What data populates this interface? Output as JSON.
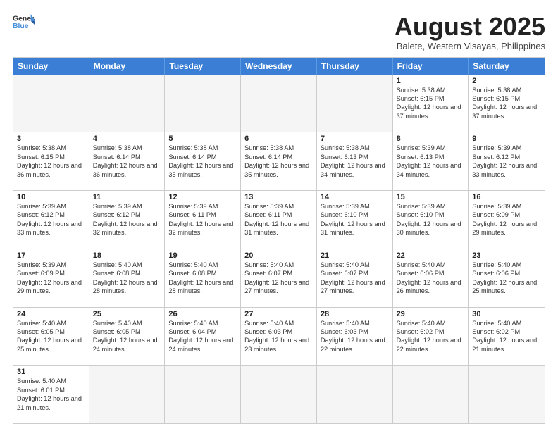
{
  "header": {
    "logo_general": "General",
    "logo_blue": "Blue",
    "month_title": "August 2025",
    "location": "Balete, Western Visayas, Philippines"
  },
  "days_of_week": [
    "Sunday",
    "Monday",
    "Tuesday",
    "Wednesday",
    "Thursday",
    "Friday",
    "Saturday"
  ],
  "weeks": [
    [
      {
        "day": "",
        "info": "",
        "empty": true
      },
      {
        "day": "",
        "info": "",
        "empty": true
      },
      {
        "day": "",
        "info": "",
        "empty": true
      },
      {
        "day": "",
        "info": "",
        "empty": true
      },
      {
        "day": "",
        "info": "",
        "empty": true
      },
      {
        "day": "1",
        "info": "Sunrise: 5:38 AM\nSunset: 6:15 PM\nDaylight: 12 hours and 37 minutes."
      },
      {
        "day": "2",
        "info": "Sunrise: 5:38 AM\nSunset: 6:15 PM\nDaylight: 12 hours and 37 minutes."
      }
    ],
    [
      {
        "day": "3",
        "info": "Sunrise: 5:38 AM\nSunset: 6:15 PM\nDaylight: 12 hours and 36 minutes."
      },
      {
        "day": "4",
        "info": "Sunrise: 5:38 AM\nSunset: 6:14 PM\nDaylight: 12 hours and 36 minutes."
      },
      {
        "day": "5",
        "info": "Sunrise: 5:38 AM\nSunset: 6:14 PM\nDaylight: 12 hours and 35 minutes."
      },
      {
        "day": "6",
        "info": "Sunrise: 5:38 AM\nSunset: 6:14 PM\nDaylight: 12 hours and 35 minutes."
      },
      {
        "day": "7",
        "info": "Sunrise: 5:38 AM\nSunset: 6:13 PM\nDaylight: 12 hours and 34 minutes."
      },
      {
        "day": "8",
        "info": "Sunrise: 5:39 AM\nSunset: 6:13 PM\nDaylight: 12 hours and 34 minutes."
      },
      {
        "day": "9",
        "info": "Sunrise: 5:39 AM\nSunset: 6:12 PM\nDaylight: 12 hours and 33 minutes."
      }
    ],
    [
      {
        "day": "10",
        "info": "Sunrise: 5:39 AM\nSunset: 6:12 PM\nDaylight: 12 hours and 33 minutes."
      },
      {
        "day": "11",
        "info": "Sunrise: 5:39 AM\nSunset: 6:12 PM\nDaylight: 12 hours and 32 minutes."
      },
      {
        "day": "12",
        "info": "Sunrise: 5:39 AM\nSunset: 6:11 PM\nDaylight: 12 hours and 32 minutes."
      },
      {
        "day": "13",
        "info": "Sunrise: 5:39 AM\nSunset: 6:11 PM\nDaylight: 12 hours and 31 minutes."
      },
      {
        "day": "14",
        "info": "Sunrise: 5:39 AM\nSunset: 6:10 PM\nDaylight: 12 hours and 31 minutes."
      },
      {
        "day": "15",
        "info": "Sunrise: 5:39 AM\nSunset: 6:10 PM\nDaylight: 12 hours and 30 minutes."
      },
      {
        "day": "16",
        "info": "Sunrise: 5:39 AM\nSunset: 6:09 PM\nDaylight: 12 hours and 29 minutes."
      }
    ],
    [
      {
        "day": "17",
        "info": "Sunrise: 5:39 AM\nSunset: 6:09 PM\nDaylight: 12 hours and 29 minutes."
      },
      {
        "day": "18",
        "info": "Sunrise: 5:40 AM\nSunset: 6:08 PM\nDaylight: 12 hours and 28 minutes."
      },
      {
        "day": "19",
        "info": "Sunrise: 5:40 AM\nSunset: 6:08 PM\nDaylight: 12 hours and 28 minutes."
      },
      {
        "day": "20",
        "info": "Sunrise: 5:40 AM\nSunset: 6:07 PM\nDaylight: 12 hours and 27 minutes."
      },
      {
        "day": "21",
        "info": "Sunrise: 5:40 AM\nSunset: 6:07 PM\nDaylight: 12 hours and 27 minutes."
      },
      {
        "day": "22",
        "info": "Sunrise: 5:40 AM\nSunset: 6:06 PM\nDaylight: 12 hours and 26 minutes."
      },
      {
        "day": "23",
        "info": "Sunrise: 5:40 AM\nSunset: 6:06 PM\nDaylight: 12 hours and 25 minutes."
      }
    ],
    [
      {
        "day": "24",
        "info": "Sunrise: 5:40 AM\nSunset: 6:05 PM\nDaylight: 12 hours and 25 minutes."
      },
      {
        "day": "25",
        "info": "Sunrise: 5:40 AM\nSunset: 6:05 PM\nDaylight: 12 hours and 24 minutes."
      },
      {
        "day": "26",
        "info": "Sunrise: 5:40 AM\nSunset: 6:04 PM\nDaylight: 12 hours and 24 minutes."
      },
      {
        "day": "27",
        "info": "Sunrise: 5:40 AM\nSunset: 6:03 PM\nDaylight: 12 hours and 23 minutes."
      },
      {
        "day": "28",
        "info": "Sunrise: 5:40 AM\nSunset: 6:03 PM\nDaylight: 12 hours and 22 minutes."
      },
      {
        "day": "29",
        "info": "Sunrise: 5:40 AM\nSunset: 6:02 PM\nDaylight: 12 hours and 22 minutes."
      },
      {
        "day": "30",
        "info": "Sunrise: 5:40 AM\nSunset: 6:02 PM\nDaylight: 12 hours and 21 minutes."
      }
    ],
    [
      {
        "day": "31",
        "info": "Sunrise: 5:40 AM\nSunset: 6:01 PM\nDaylight: 12 hours and 21 minutes."
      },
      {
        "day": "",
        "info": "",
        "empty": true
      },
      {
        "day": "",
        "info": "",
        "empty": true
      },
      {
        "day": "",
        "info": "",
        "empty": true
      },
      {
        "day": "",
        "info": "",
        "empty": true
      },
      {
        "day": "",
        "info": "",
        "empty": true
      },
      {
        "day": "",
        "info": "",
        "empty": true
      }
    ]
  ]
}
